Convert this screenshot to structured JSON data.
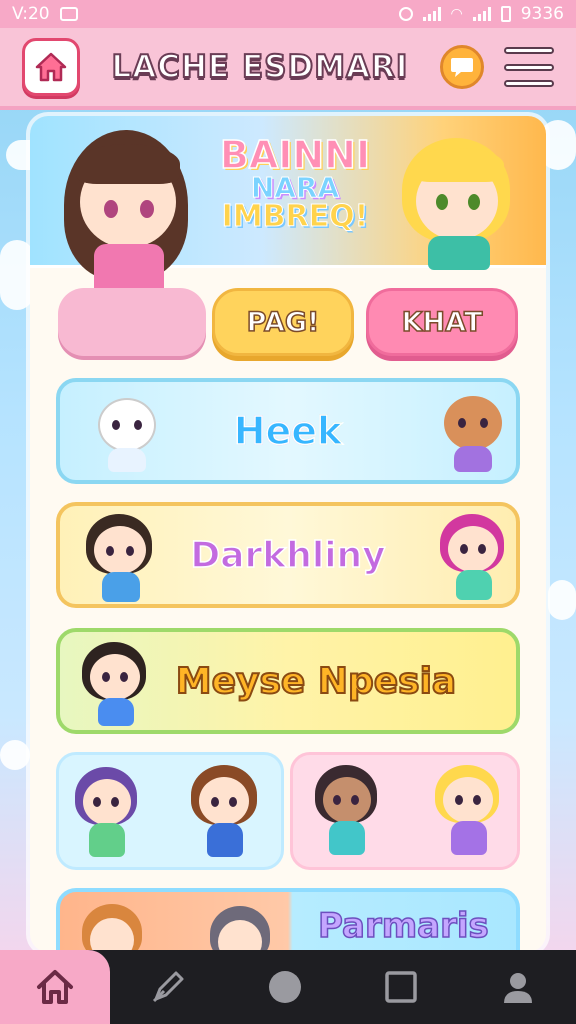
{
  "status_bar": {
    "time": "V:20",
    "battery": "9336"
  },
  "header": {
    "title": "LACHE ESDMARI"
  },
  "banner": {
    "line1": "BAINNI",
    "line2": "NARA",
    "line3": "IMBREQ!"
  },
  "buttons": {
    "left": "",
    "middle": "PAG!",
    "right": "KHAT"
  },
  "categories": [
    {
      "label": "Heek"
    },
    {
      "label": "Darkhliny"
    },
    {
      "label": "Meyse Npesia"
    },
    {
      "label": "Parmaris"
    }
  ],
  "colors": {
    "header_bg": "#f9c4d7",
    "accent_pink": "#ff8ab2",
    "accent_yellow": "#ffd35c",
    "nav_bg": "#1e1e22"
  },
  "icons": {
    "header_left": "home-icon",
    "header_chat": "chat-bubble-icon",
    "header_menu": "menu-icon",
    "nav": [
      "home-icon",
      "edit-icon",
      "circle-icon",
      "square-icon",
      "profile-icon"
    ]
  }
}
